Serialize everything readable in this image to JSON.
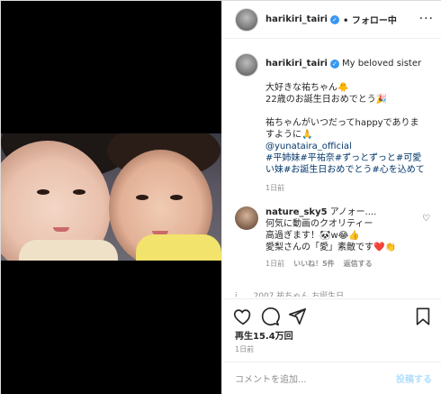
{
  "header": {
    "username": "harikiri_tairi",
    "follow_label": "• フォロー中",
    "more_icon": "more-icon"
  },
  "caption": {
    "username": "harikiri_tairi",
    "subtitle": "My beloved sister",
    "lines": [
      "大好きな祐ちゃん🐥",
      "22歳のお誕生日おめでとう🎉"
    ],
    "lines2": [
      "祐ちゃんがいつだってhappyでありま",
      "すように🙏"
    ],
    "mention": "@yunataira_official",
    "hashtags": [
      "#平姉妹#平祐奈#ずっとずっと#可愛",
      "い妹#お誕生日おめでとう#心を込めて"
    ],
    "time": "1日前"
  },
  "comment": {
    "username": "nature_sky5",
    "lines": [
      " アノォー....",
      "何気に動画のクオリティー",
      "高過ぎます！🐼w😂👍",
      "愛梨さんの「愛」素敵です❤️👏"
    ],
    "time": "1日前",
    "likes": "いいね！5件",
    "reply": "返信する"
  },
  "peek_text": "i  2007 祐ちゃん お誕生日",
  "stats": {
    "views": "再生15.4万回",
    "date": "1日前"
  },
  "add_comment": {
    "placeholder": "コメントを追加...",
    "post_label": "投稿する"
  },
  "colors": {
    "link": "#00376b",
    "verified": "#3897f0",
    "post_disabled": "#b2dffc"
  }
}
